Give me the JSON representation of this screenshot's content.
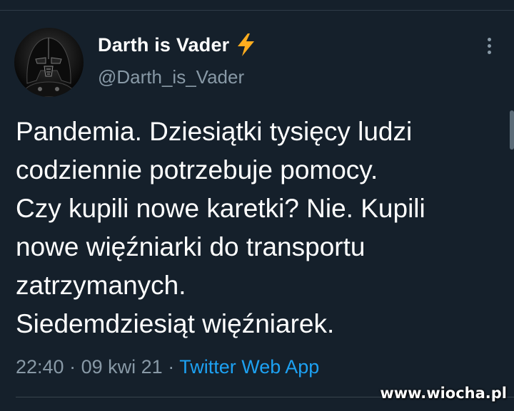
{
  "author": {
    "display_name": "Darth is Vader",
    "verified_badge": "lightning-bolt-icon",
    "handle": "@Darth_is_Vader"
  },
  "tweet": {
    "lines": [
      "Pandemia. Dziesiątki tysięcy ludzi",
      "codziennie potrzebuje pomocy.",
      "Czy kupili nowe karetki? Nie. Kupili",
      "nowe więźniarki do transportu",
      "zatrzymanych.",
      "Siedemdziesiąt więźniarek."
    ],
    "time": "22:40",
    "date": "09 kwi 21",
    "separator": "·",
    "source": "Twitter Web App"
  },
  "watermark": "www.wiocha.pl",
  "colors": {
    "background": "#15202b",
    "secondary_text": "#8899a6",
    "link": "#1da1f2",
    "bolt": "#ffad1f"
  }
}
